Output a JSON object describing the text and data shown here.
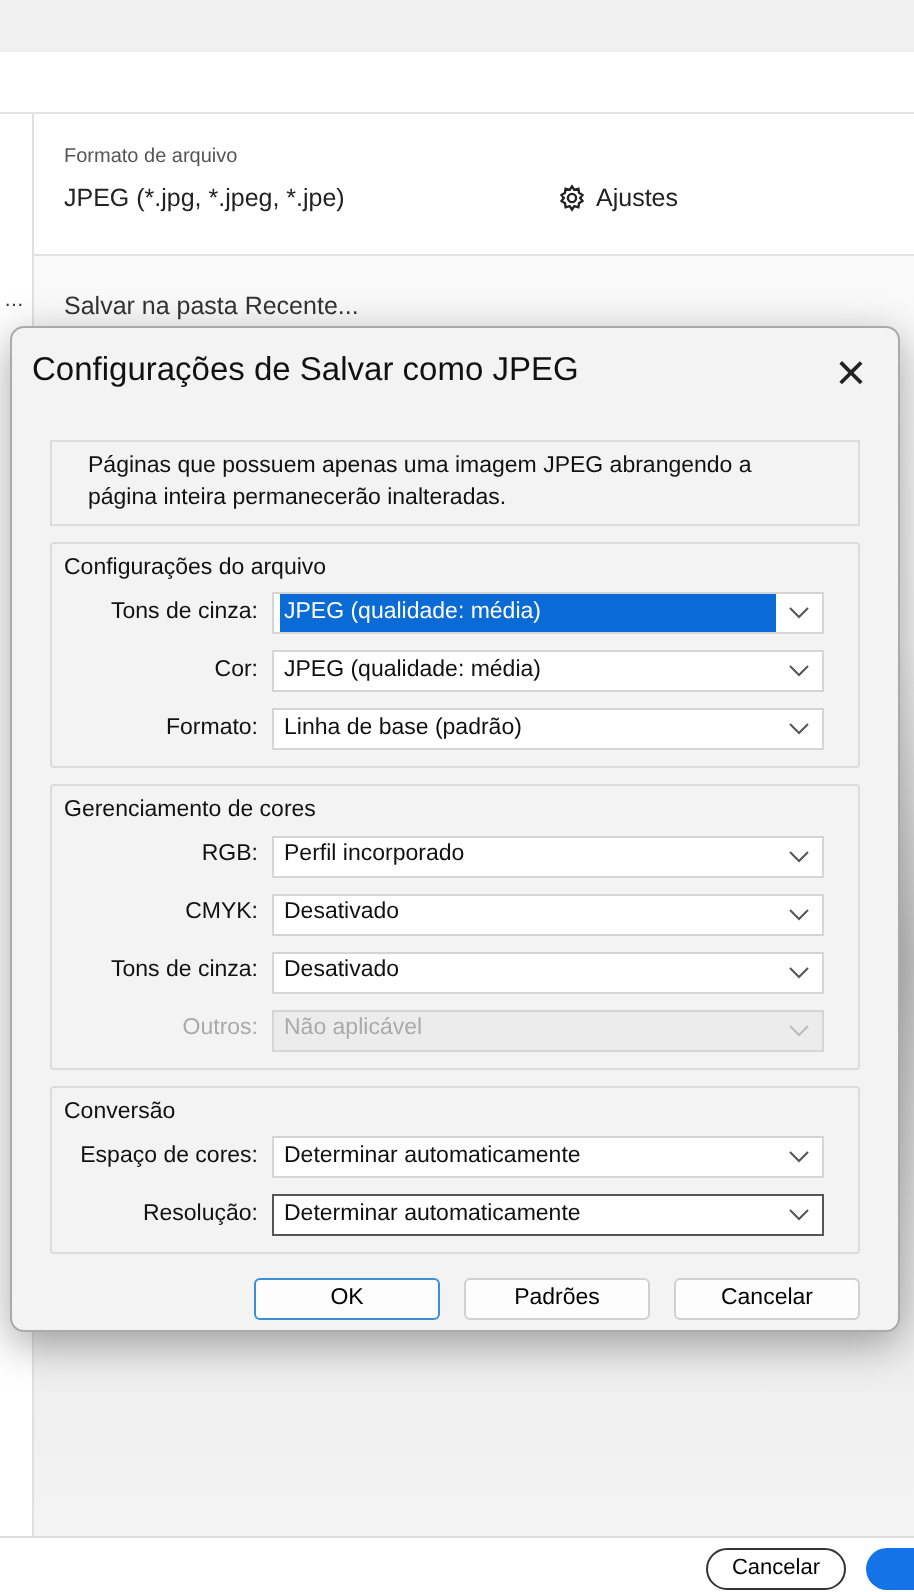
{
  "sidebar": {
    "items": [
      {
        "text": "…"
      }
    ]
  },
  "file_format": {
    "label": "Formato de arquivo",
    "value": "JPEG (*.jpg, *.jpeg, *.jpe)",
    "settings_button": "Ajustes"
  },
  "save_location": "Salvar na pasta Recente...",
  "dialog": {
    "title": "Configurações de Salvar como JPEG",
    "close": "×",
    "info": "Páginas que possuem apenas uma imagem JPEG abrangendo a página inteira permanecerão inalteradas.",
    "groups": [
      {
        "title": "Configurações do arquivo",
        "fields": [
          {
            "label": "Tons de cinza:",
            "value": "JPEG (qualidade: média)",
            "selected": true,
            "disabled": false,
            "focused": false
          },
          {
            "label": "Cor:",
            "value": "JPEG (qualidade: média)",
            "selected": false,
            "disabled": false,
            "focused": false
          },
          {
            "label": "Formato:",
            "value": "Linha de base (padrão)",
            "selected": false,
            "disabled": false,
            "focused": false
          }
        ]
      },
      {
        "title": "Gerenciamento de cores",
        "fields": [
          {
            "label": "RGB:",
            "value": "Perfil incorporado",
            "selected": false,
            "disabled": false,
            "focused": false
          },
          {
            "label": "CMYK:",
            "value": "Desativado",
            "selected": false,
            "disabled": false,
            "focused": false
          },
          {
            "label": "Tons de cinza:",
            "value": "Desativado",
            "selected": false,
            "disabled": false,
            "focused": false
          },
          {
            "label": "Outros:",
            "value": "Não aplicável",
            "selected": false,
            "disabled": true,
            "focused": false
          }
        ]
      },
      {
        "title": "Conversão",
        "fields": [
          {
            "label": "Espaço de cores:",
            "value": "Determinar automaticamente",
            "selected": false,
            "disabled": false,
            "focused": false
          },
          {
            "label": "Resolução:",
            "value": "Determinar automaticamente",
            "selected": false,
            "disabled": false,
            "focused": true
          }
        ]
      }
    ],
    "buttons": [
      {
        "label": "OK",
        "default": true
      },
      {
        "label": "Padrões",
        "default": false
      },
      {
        "label": "Cancelar",
        "default": false
      }
    ]
  },
  "footer_buttons": [
    {
      "label": "Cancelar",
      "kind": "outline"
    },
    {
      "kind": "primary"
    }
  ]
}
